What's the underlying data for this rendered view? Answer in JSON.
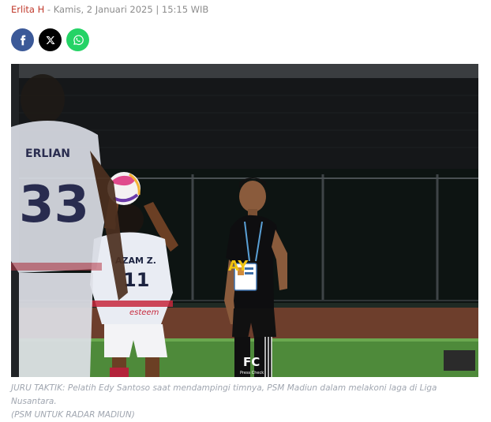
{
  "article_meta": {
    "author": "Erlita H",
    "separator": " - ",
    "date": "Kamis, 2 Januari 2025 | 15:15 WIB"
  },
  "share": {
    "buttons": [
      {
        "icon": "facebook-icon",
        "color": "#3b5998"
      },
      {
        "icon": "x-icon",
        "color": "#000000"
      },
      {
        "icon": "whatsapp-icon",
        "color": "#25d366"
      }
    ]
  },
  "photo": {
    "player_left_number": "33",
    "player_left_name": "ERLIAN",
    "player_center_name": "AZAM Z.",
    "player_center_number": "11",
    "sponsor_text": "esteem",
    "coach_shirt_text": "AY",
    "watermark": "FC",
    "watermark_sub": "Press Check"
  },
  "caption": {
    "line1": "JURU TAKTIK: Pelatih Edy Santoso saat mendampingi timnya, PSM Madiun dalam melakoni laga di Liga Nusantara.",
    "line2": "(PSM UNTUK RADAR MADIUN)"
  }
}
